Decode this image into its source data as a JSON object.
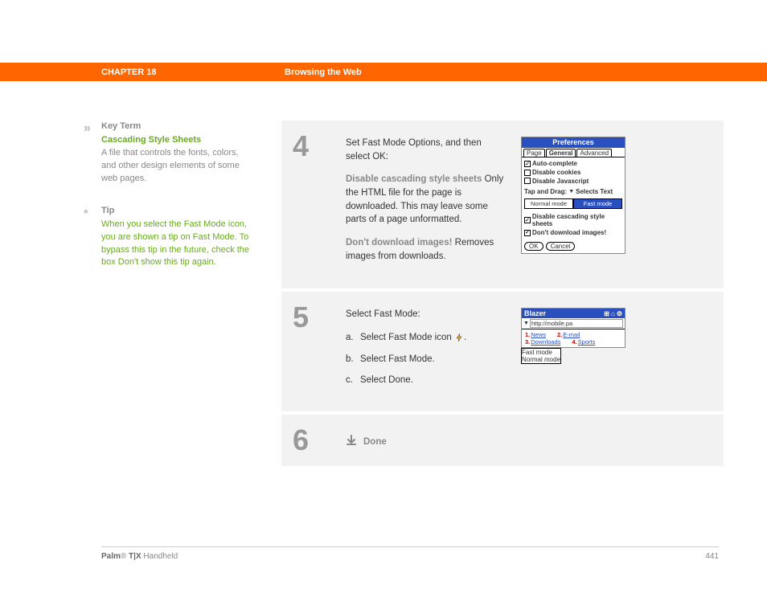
{
  "header": {
    "chapter": "CHAPTER 18",
    "title": "Browsing the Web"
  },
  "sidebar": {
    "keyterm": {
      "marker": "»",
      "label": "Key Term",
      "term": "Cascading Style Sheets",
      "body": "A file that controls the fonts, colors, and other design elements of some web pages."
    },
    "tip": {
      "marker": "*",
      "label": "Tip",
      "body": "When you select the Fast Mode icon, you are shown a tip on Fast Mode. To bypass this tip in the future, check the box Don't show this tip again."
    }
  },
  "steps": {
    "s4": {
      "num": "4",
      "intro": "Set Fast Mode Options, and then select OK:",
      "opt1_title": "Disable cascading style sheets",
      "opt1_body": "Only the HTML file for the page is downloaded. This may leave some parts of a page unformatted.",
      "opt2_title": "Don't download images!",
      "opt2_body": "Removes images from downloads."
    },
    "s5": {
      "num": "5",
      "intro": "Select Fast Mode:",
      "a": "Select Fast Mode icon ",
      "a_suffix": ".",
      "b": "Select Fast Mode.",
      "c": "Select Done."
    },
    "s6": {
      "num": "6",
      "done": "Done"
    }
  },
  "preferences_screenshot": {
    "title": "Preferences",
    "tabs": {
      "page": "Page",
      "general": "General",
      "advanced": "Advanced"
    },
    "options": {
      "auto": "Auto-complete",
      "cookies": "Disable cookies",
      "js": "Disable Javascript"
    },
    "tapdrag_label": "Tap and Drag:",
    "tapdrag_value": "Selects Text",
    "modes": {
      "normal": "Normal mode",
      "fast": "Fast mode"
    },
    "fast_options": {
      "css": "Disable cascading style sheets",
      "img": "Don't download images!"
    },
    "buttons": {
      "ok": "OK",
      "cancel": "Cancel"
    }
  },
  "blazer_screenshot": {
    "title": "Blazer",
    "url": "http://mobile.pa",
    "menu": {
      "fast": "Fast mode",
      "normal": "Normal mode"
    },
    "links": {
      "l1": "News",
      "l2": "E-mail",
      "l3": "Downloads",
      "l4": "Sports"
    }
  },
  "footer": {
    "product_bold": "Palm",
    "product_reg": "®",
    "product_model": " T|X",
    "product_suffix": " Handheld",
    "page": "441"
  }
}
